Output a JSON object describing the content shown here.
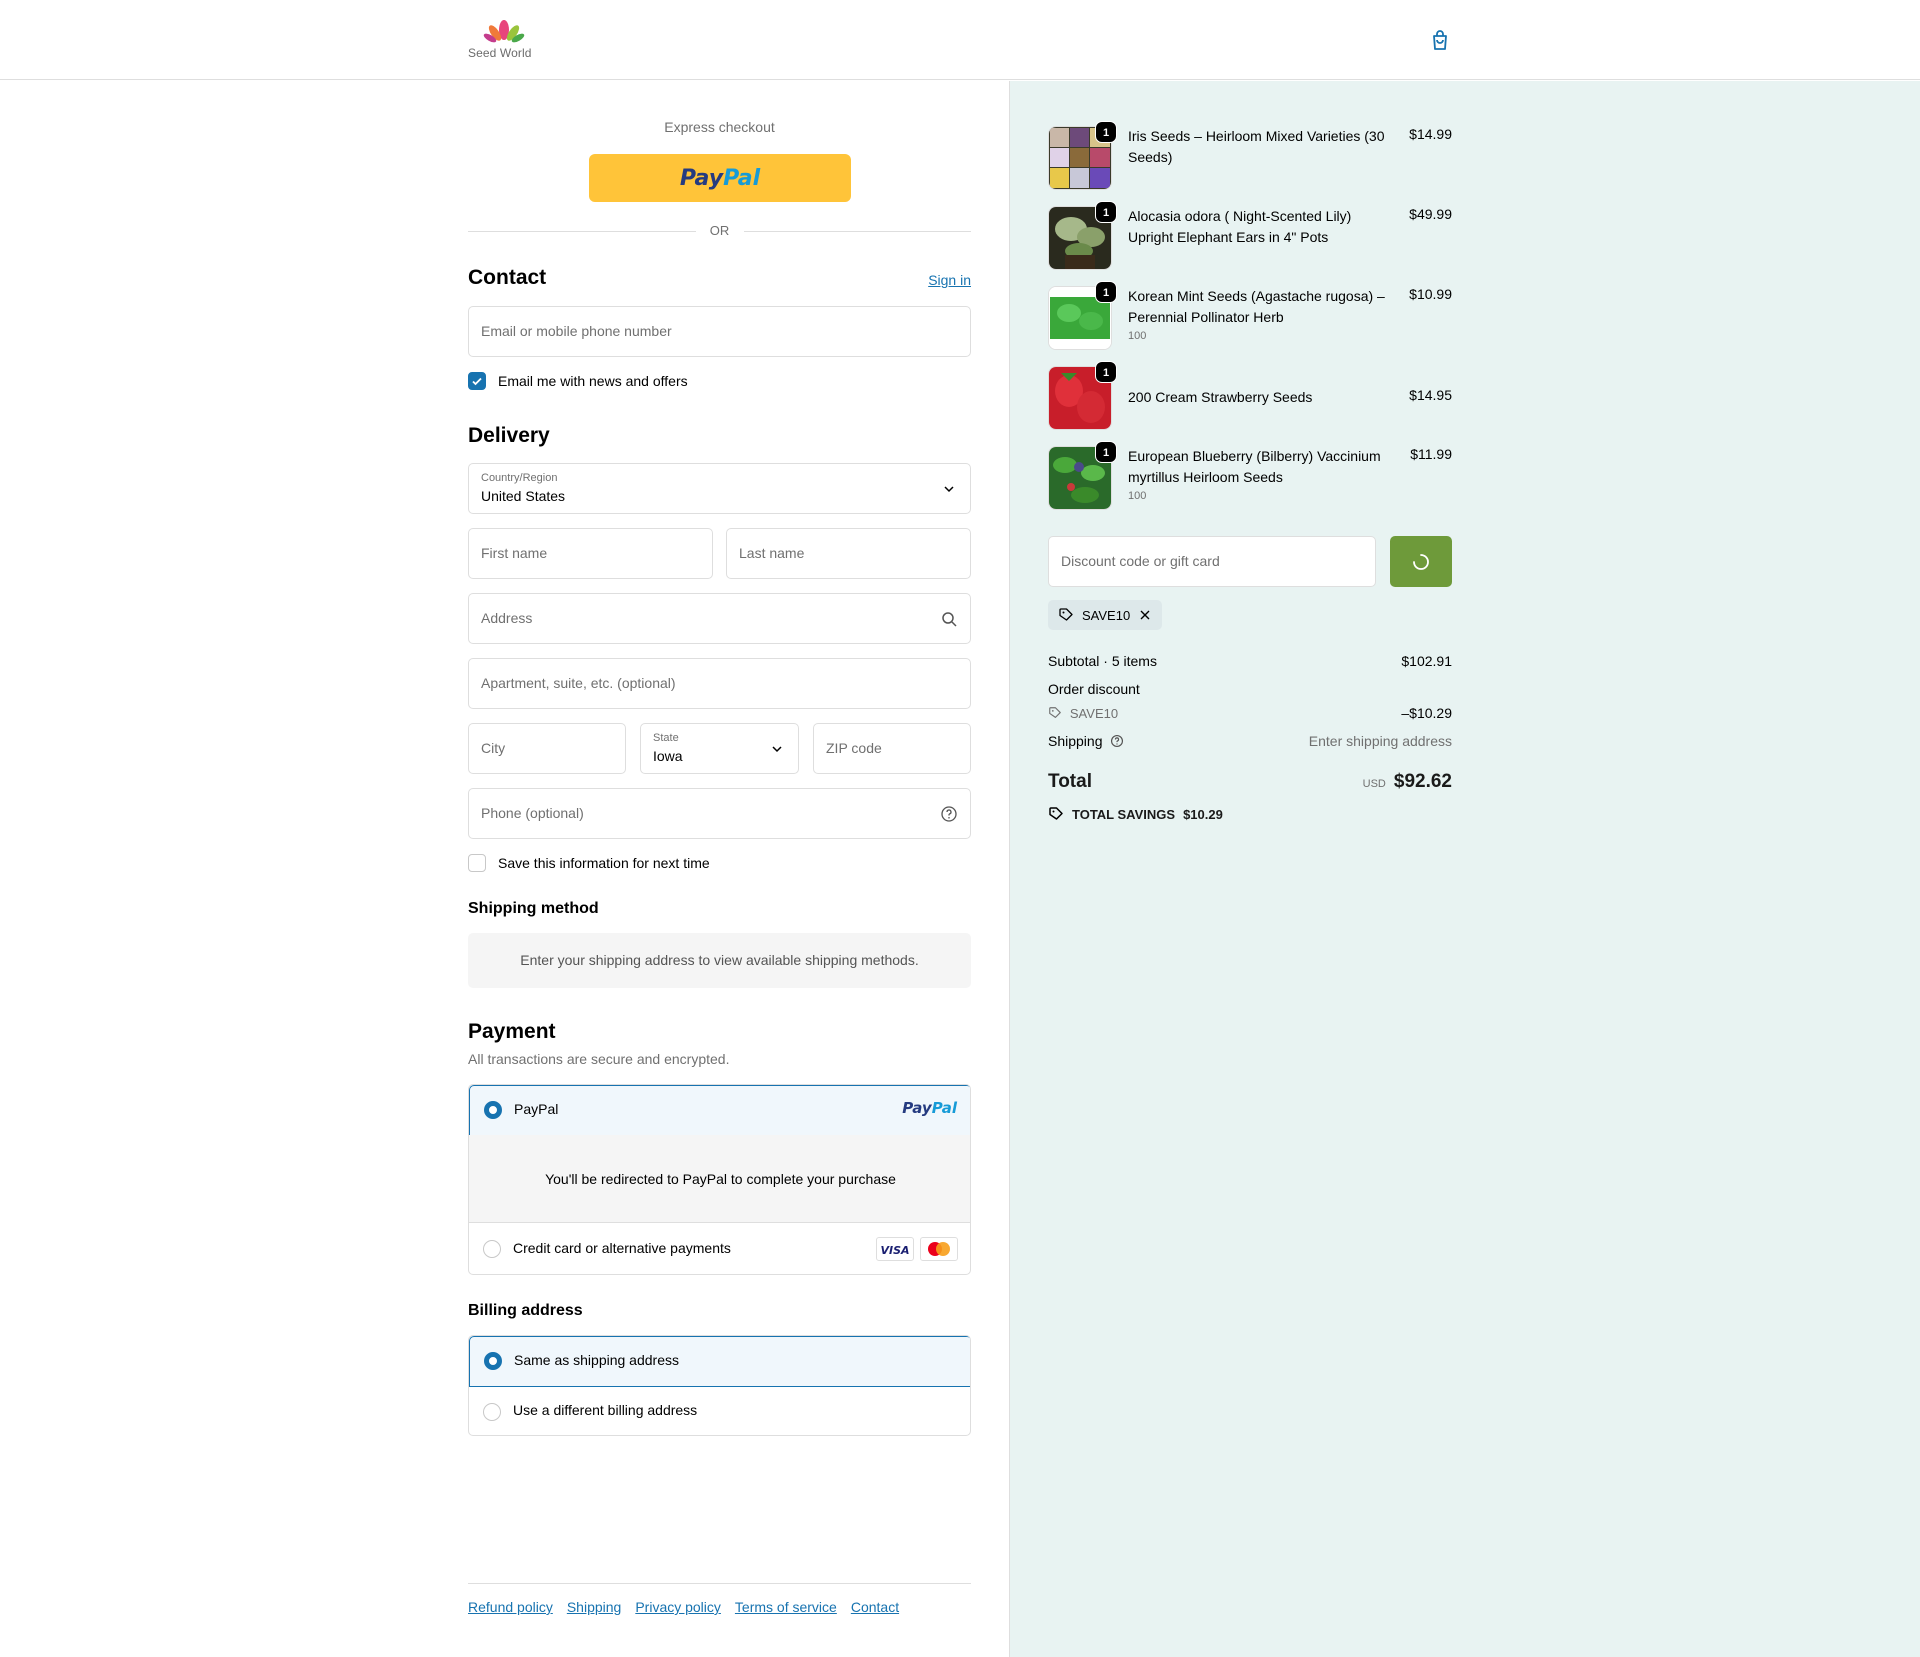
{
  "header": {
    "brand": "Seed World"
  },
  "express": {
    "label": "Express checkout",
    "paypal_p1": "Pay",
    "paypal_p2": "Pal",
    "or": "OR"
  },
  "contact": {
    "title": "Contact",
    "sign_in": "Sign in",
    "email_placeholder": "Email or mobile phone number",
    "news_label": "Email me with news and offers"
  },
  "delivery": {
    "title": "Delivery",
    "country_label": "Country/Region",
    "country_value": "United States",
    "first_name": "First name",
    "last_name": "Last name",
    "address": "Address",
    "apartment": "Apartment, suite, etc. (optional)",
    "city": "City",
    "state_label": "State",
    "state_value": "Iowa",
    "zip": "ZIP code",
    "phone": "Phone (optional)",
    "save_label": "Save this information for next time"
  },
  "shipping_method": {
    "title": "Shipping method",
    "info": "Enter your shipping address to view available shipping methods."
  },
  "payment": {
    "title": "Payment",
    "subtitle": "All transactions are secure and encrypted.",
    "paypal_label": "PayPal",
    "redirect_text": "You'll be redirected to PayPal to complete your purchase",
    "card_label": "Credit card or alternative payments",
    "visa": "VISA"
  },
  "billing": {
    "title": "Billing address",
    "same": "Same as shipping address",
    "different": "Use a different billing address"
  },
  "footer": {
    "links": [
      "Refund policy",
      "Shipping",
      "Privacy policy",
      "Terms of service",
      "Contact"
    ]
  },
  "cart": {
    "items": [
      {
        "name": "Iris Seeds – Heirloom Mixed Varieties (30 Seeds)",
        "variant": "",
        "price": "$14.99",
        "qty": "1"
      },
      {
        "name": "Alocasia odora ( Night-Scented Lily) Upright Elephant Ears in 4\" Pots",
        "variant": "",
        "price": "$49.99",
        "qty": "1"
      },
      {
        "name": "Korean Mint Seeds (Agastache rugosa) – Perennial Pollinator Herb",
        "variant": "100",
        "price": "$10.99",
        "qty": "1"
      },
      {
        "name": "200 Cream Strawberry Seeds",
        "variant": "",
        "price": "$14.95",
        "qty": "1"
      },
      {
        "name": "European Blueberry (Bilberry) Vaccinium myrtillus Heirloom Seeds",
        "variant": "100",
        "price": "$11.99",
        "qty": "1"
      }
    ],
    "discount_placeholder": "Discount code or gift card",
    "applied_code": "SAVE10",
    "subtotal_label": "Subtotal · 5 items",
    "subtotal_value": "$102.91",
    "order_discount_label": "Order discount",
    "discount_code": "SAVE10",
    "discount_value": "–$10.29",
    "shipping_label": "Shipping",
    "shipping_value": "Enter shipping address",
    "total_label": "Total",
    "currency": "USD",
    "total_value": "$92.62",
    "savings_label": "TOTAL SAVINGS",
    "savings_value": "$10.29"
  },
  "colors": {
    "accent": "#1773b0",
    "paypal_yellow": "#ffc439",
    "apply_green": "#6e9a3a",
    "summary_bg": "#e8f3f2"
  }
}
